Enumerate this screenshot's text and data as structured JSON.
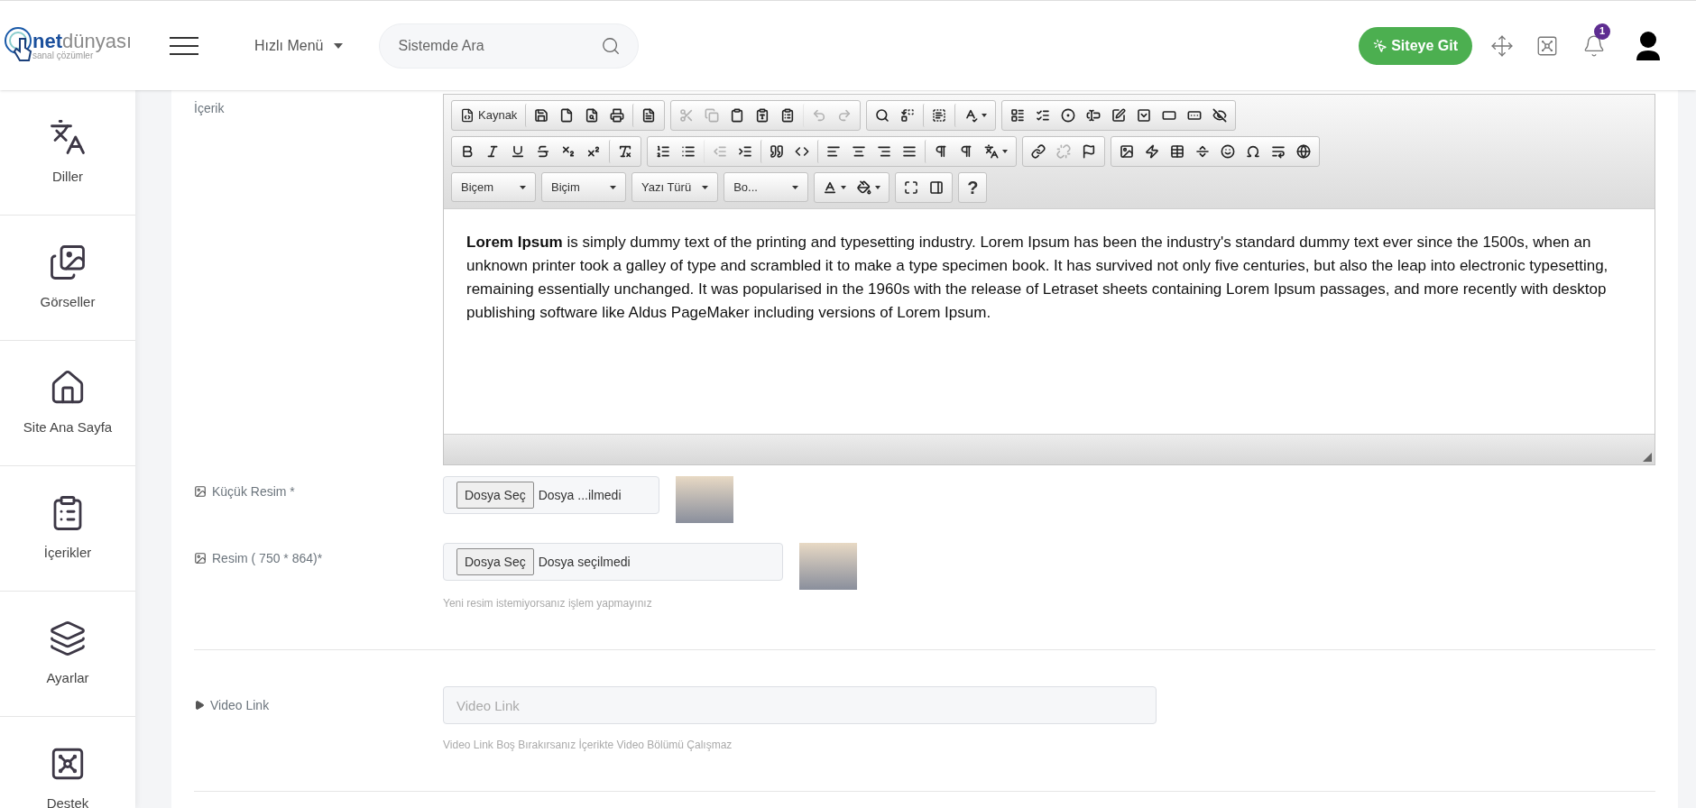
{
  "header": {
    "logo": {
      "brand_bold": "net",
      "brand_light": "dünyası",
      "tagline": "sanal çözümler"
    },
    "quick_menu": "Hızlı Menü",
    "search": {
      "placeholder": "Sistemde Ara"
    },
    "site_button": "Siteye Git",
    "notification_count": "1"
  },
  "sidebar": {
    "items": [
      {
        "label": "Diller"
      },
      {
        "label": "Görseller"
      },
      {
        "label": "Site Ana Sayfa"
      },
      {
        "label": "İçerikler"
      },
      {
        "label": "Ayarlar"
      },
      {
        "label": "Destek"
      }
    ]
  },
  "form": {
    "content_label": "İçerik",
    "editor": {
      "toolbar_rows": [
        [
          [
            {
              "label": "Kaynak",
              "disabled": false,
              "divider_before": false
            },
            {
              "disabled": false,
              "divider_before": true
            },
            {
              "disabled": false,
              "divider_before": false
            },
            {
              "disabled": false,
              "divider_before": false
            },
            {
              "disabled": false,
              "divider_before": false
            },
            {
              "disabled": false,
              "divider_before": true
            }
          ],
          [
            {
              "disabled": true,
              "divider_before": false
            },
            {
              "disabled": true,
              "divider_before": false
            },
            {
              "disabled": false,
              "divider_before": false
            },
            {
              "disabled": false,
              "divider_before": false
            },
            {
              "disabled": false,
              "divider_before": false
            },
            {
              "disabled": true,
              "divider_before": true
            },
            {
              "disabled": true,
              "divider_before": false
            }
          ],
          [
            {
              "disabled": false,
              "divider_before": false
            },
            {
              "disabled": false,
              "divider_before": false
            },
            {
              "disabled": false,
              "divider_before": true
            },
            {
              "disabled": false,
              "divider_before": true,
              "has_menu": true
            }
          ],
          [
            {
              "disabled": false,
              "divider_before": false
            },
            {
              "disabled": false,
              "divider_before": false
            },
            {
              "disabled": false,
              "divider_before": false
            },
            {
              "disabled": false,
              "divider_before": false
            },
            {
              "disabled": false,
              "divider_before": false
            },
            {
              "disabled": false,
              "divider_before": false
            },
            {
              "disabled": false,
              "divider_before": false
            },
            {
              "disabled": false,
              "divider_before": false
            },
            {
              "disabled": false,
              "divider_before": false
            }
          ]
        ],
        [
          [
            {
              "disabled": false,
              "divider_before": false
            },
            {
              "disabled": false,
              "divider_before": false
            },
            {
              "disabled": false,
              "divider_before": false
            },
            {
              "disabled": false,
              "divider_before": false
            },
            {
              "disabled": false,
              "divider_before": false
            },
            {
              "disabled": false,
              "divider_before": false
            },
            {
              "disabled": false,
              "divider_before": true
            }
          ],
          [
            {
              "disabled": false,
              "divider_before": false
            },
            {
              "disabled": false,
              "divider_before": false
            },
            {
              "disabled": true,
              "divider_before": true
            },
            {
              "disabled": false,
              "divider_before": false
            },
            {
              "disabled": false,
              "divider_before": true
            },
            {
              "disabled": false,
              "divider_before": false
            },
            {
              "disabled": false,
              "divider_before": true
            },
            {
              "disabled": false,
              "divider_before": false
            },
            {
              "disabled": false,
              "divider_before": false
            },
            {
              "disabled": false,
              "divider_before": false
            },
            {
              "disabled": false,
              "divider_before": true
            },
            {
              "disabled": false,
              "divider_before": false
            },
            {
              "disabled": false,
              "divider_before": false,
              "has_menu": true
            }
          ],
          [
            {
              "disabled": false,
              "divider_before": false
            },
            {
              "disabled": true,
              "divider_before": false
            },
            {
              "disabled": false,
              "divider_before": false
            }
          ],
          [
            {
              "disabled": false,
              "divider_before": false
            },
            {
              "disabled": false,
              "divider_before": false
            },
            {
              "disabled": false,
              "divider_before": false
            },
            {
              "disabled": false,
              "divider_before": false
            },
            {
              "disabled": false,
              "divider_before": false
            },
            {
              "disabled": false,
              "divider_before": false
            },
            {
              "disabled": false,
              "divider_before": false
            },
            {
              "disabled": false,
              "divider_before": false
            }
          ]
        ],
        [
          [
            {
              "kind": "combo",
              "label": "Biçem"
            }
          ],
          [
            {
              "kind": "combo",
              "label": "Biçim"
            }
          ],
          [
            {
              "kind": "combo",
              "label": "Yazı Türü"
            }
          ],
          [
            {
              "kind": "combo",
              "label": "Bo..."
            }
          ],
          [
            {
              "disabled": false,
              "divider_before": false,
              "has_menu": true
            },
            {
              "disabled": false,
              "divider_before": false,
              "has_menu": true
            }
          ],
          [
            {
              "disabled": false,
              "divider_before": false
            },
            {
              "disabled": false,
              "divider_before": false
            }
          ],
          [
            {
              "label": "?",
              "disabled": false,
              "divider_before": false
            }
          ]
        ]
      ],
      "body": "**Lorem Ipsum** is simply dummy text of the printing and typesetting industry. Lorem Ipsum has been the industry's standard dummy text ever since the 1500s, when an unknown printer took a galley of type and scrambled it to make a type specimen book. It has survived not only five centuries, but also the leap into electronic typesetting, remaining essentially unchanged. It was popularised in the 1960s with the release of Letraset sheets containing Lorem Ipsum passages, and more recently with desktop publishing software like Aldus PageMaker including versions of Lorem Ipsum."
    },
    "small_image": {
      "label": "Küçük Resim *",
      "button": "Dosya Seç",
      "file_status": "Dosya ...ilmedi"
    },
    "image": {
      "label": "Resim ( 750 * 864)*",
      "button": "Dosya Seç",
      "file_status": "Dosya seçilmedi",
      "hint": "Yeni resim istemiyorsanız işlem yapmayınız"
    },
    "video": {
      "label": "Video Link",
      "placeholder": "Video Link",
      "hint": "Video Link Boş Bırakırsanız İçerikte Video Bölümü Çalışmaz"
    }
  }
}
